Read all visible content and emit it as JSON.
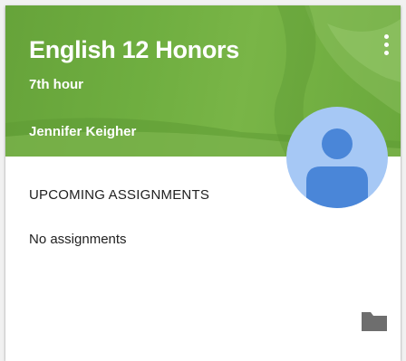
{
  "card": {
    "title": "English 12 Honors",
    "section": "7th hour",
    "teacher": "Jennifer Keigher",
    "theme_color": "#6fae40",
    "avatar_color": "#a6c8f5",
    "avatar_figure_color": "#4a86d8"
  },
  "assignments": {
    "heading": "UPCOMING ASSIGNMENTS",
    "empty_text": "No assignments"
  },
  "icons": {
    "menu": "more-vert-icon",
    "folder": "folder-icon",
    "avatar": "person-icon"
  }
}
